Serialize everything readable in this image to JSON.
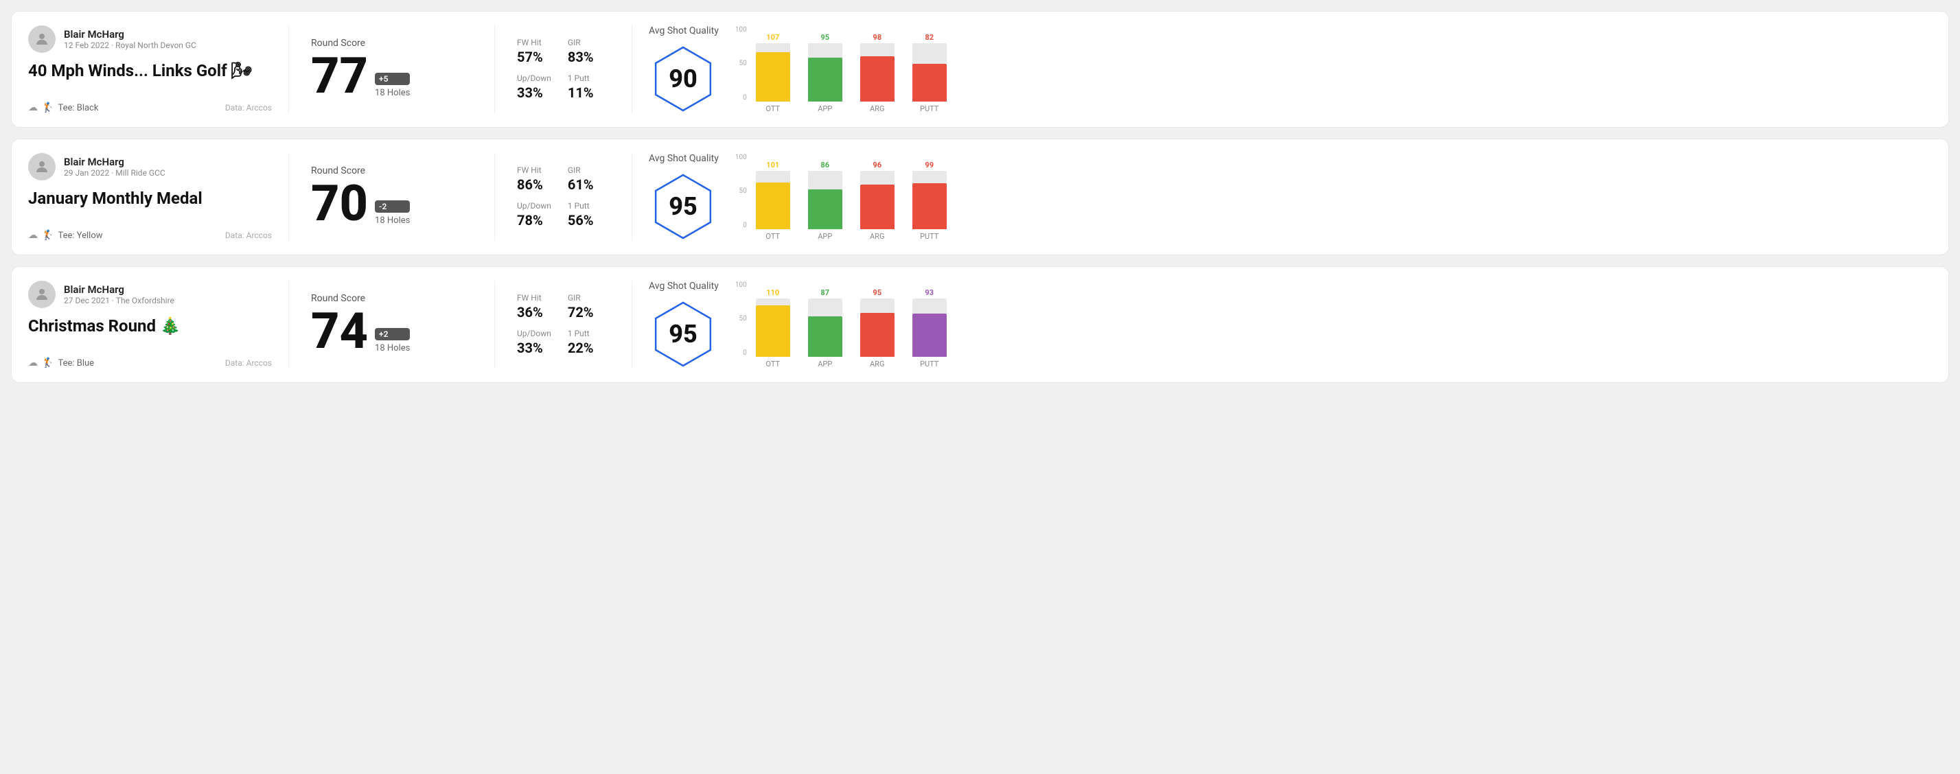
{
  "rounds": [
    {
      "id": "round-1",
      "user": {
        "name": "Blair McHarg",
        "date": "12 Feb 2022",
        "course": "Royal North Devon GC",
        "avatar": "👤"
      },
      "title": "40 Mph Winds... Links Golf 🌬",
      "tee": "Black",
      "data_source": "Data: Arccos",
      "round_score_label": "Round Score",
      "score": "77",
      "badge": "+5",
      "holes": "18 Holes",
      "stats": {
        "fw_hit_label": "FW Hit",
        "fw_hit_value": "57%",
        "gir_label": "GIR",
        "gir_value": "83%",
        "up_down_label": "Up/Down",
        "up_down_value": "33%",
        "one_putt_label": "1 Putt",
        "one_putt_value": "11%"
      },
      "avg_shot_quality_label": "Avg Shot Quality",
      "quality_score": "90",
      "chart": {
        "bars": [
          {
            "label": "OTT",
            "value": 107,
            "color": "#f5c518",
            "height_pct": 85
          },
          {
            "label": "APP",
            "value": 95,
            "color": "#4CAF50",
            "height_pct": 75
          },
          {
            "label": "ARG",
            "value": 98,
            "color": "#e74c3c",
            "height_pct": 78
          },
          {
            "label": "PUTT",
            "value": 82,
            "color": "#e74c3c",
            "height_pct": 65
          }
        ],
        "y_labels": [
          "100",
          "50",
          "0"
        ]
      }
    },
    {
      "id": "round-2",
      "user": {
        "name": "Blair McHarg",
        "date": "29 Jan 2022",
        "course": "Mill Ride GCC",
        "avatar": "👤"
      },
      "title": "January Monthly Medal",
      "tee": "Yellow",
      "data_source": "Data: Arccos",
      "round_score_label": "Round Score",
      "score": "70",
      "badge": "-2",
      "holes": "18 Holes",
      "stats": {
        "fw_hit_label": "FW Hit",
        "fw_hit_value": "86%",
        "gir_label": "GIR",
        "gir_value": "61%",
        "up_down_label": "Up/Down",
        "up_down_value": "78%",
        "one_putt_label": "1 Putt",
        "one_putt_value": "56%"
      },
      "avg_shot_quality_label": "Avg Shot Quality",
      "quality_score": "95",
      "chart": {
        "bars": [
          {
            "label": "OTT",
            "value": 101,
            "color": "#f5c518",
            "height_pct": 80
          },
          {
            "label": "APP",
            "value": 86,
            "color": "#4CAF50",
            "height_pct": 68
          },
          {
            "label": "ARG",
            "value": 96,
            "color": "#e74c3c",
            "height_pct": 76
          },
          {
            "label": "PUTT",
            "value": 99,
            "color": "#e74c3c",
            "height_pct": 79
          }
        ],
        "y_labels": [
          "100",
          "50",
          "0"
        ]
      }
    },
    {
      "id": "round-3",
      "user": {
        "name": "Blair McHarg",
        "date": "27 Dec 2021",
        "course": "The Oxfordshire",
        "avatar": "👤"
      },
      "title": "Christmas Round 🎄",
      "tee": "Blue",
      "data_source": "Data: Arccos",
      "round_score_label": "Round Score",
      "score": "74",
      "badge": "+2",
      "holes": "18 Holes",
      "stats": {
        "fw_hit_label": "FW Hit",
        "fw_hit_value": "36%",
        "gir_label": "GIR",
        "gir_value": "72%",
        "up_down_label": "Up/Down",
        "up_down_value": "33%",
        "one_putt_label": "1 Putt",
        "one_putt_value": "22%"
      },
      "avg_shot_quality_label": "Avg Shot Quality",
      "quality_score": "95",
      "chart": {
        "bars": [
          {
            "label": "OTT",
            "value": 110,
            "color": "#f5c518",
            "height_pct": 88
          },
          {
            "label": "APP",
            "value": 87,
            "color": "#4CAF50",
            "height_pct": 69
          },
          {
            "label": "ARG",
            "value": 95,
            "color": "#e74c3c",
            "height_pct": 75
          },
          {
            "label": "PUTT",
            "value": 93,
            "color": "#9b59b6",
            "height_pct": 74
          }
        ],
        "y_labels": [
          "100",
          "50",
          "0"
        ]
      }
    }
  ]
}
